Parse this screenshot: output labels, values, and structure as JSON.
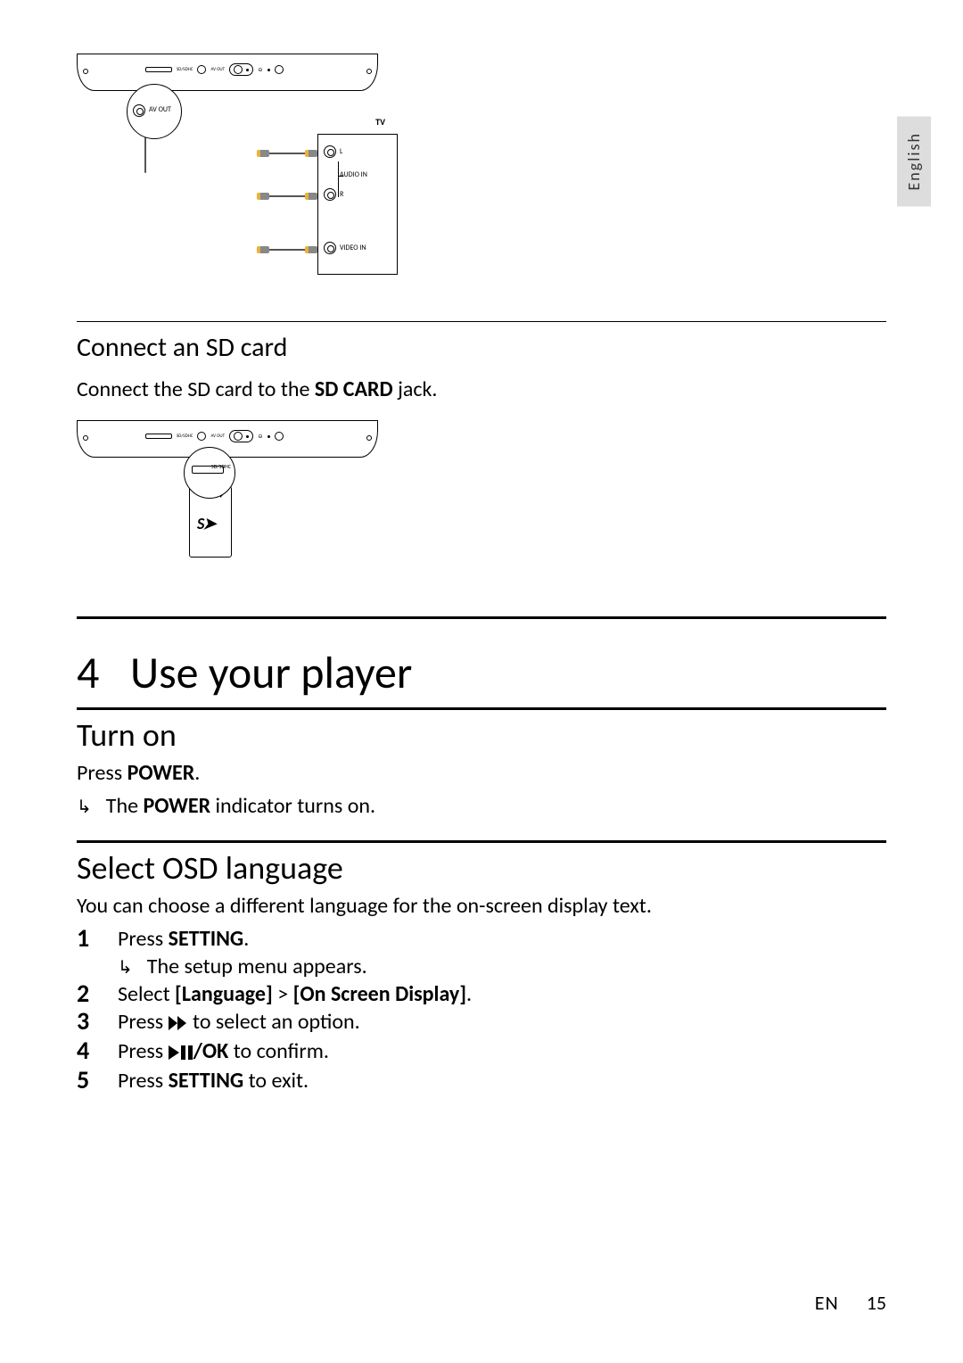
{
  "language_tab": "English",
  "diagram1": {
    "av_out_label": "AV OUT",
    "tv_label": "TV",
    "audio_l": "L",
    "audio_r": "R",
    "audio_in": "AUDIO IN",
    "video_in": "VIDEO IN",
    "sd_tiny": "SD/SDHC",
    "avout_tiny": "AV OUT"
  },
  "diagram2": {
    "sd_tiny": "SD/SDHC",
    "sd_logo": "S➤"
  },
  "subsection_sd_title": "Connect an SD card",
  "sd_instruction_pre": "Connect the SD card to the ",
  "sd_instruction_bold": "SD CARD",
  "sd_instruction_post": " jack.",
  "chapter": {
    "number": "4",
    "title": "Use your player"
  },
  "section_turn_on": {
    "title": "Turn on",
    "line_pre": "Press ",
    "line_bold": "POWER",
    "line_post": ".",
    "result_pre": "The ",
    "result_bold": "POWER",
    "result_post": " indicator turns on."
  },
  "section_osd": {
    "title": "Select OSD language",
    "intro": "You can choose a different language for the on-screen display text.",
    "steps": {
      "s1_pre": "Press ",
      "s1_bold": "SETTING",
      "s1_post": ".",
      "s1_result": "The setup menu appears.",
      "s2_pre": "Select ",
      "s2_b1": "[Language]",
      "s2_mid": " > ",
      "s2_b2": "[On Screen Display]",
      "s2_post": ".",
      "s3_pre": "Press ",
      "s3_post": " to select an option.",
      "s4_pre": "Press ",
      "s4_bold": "/OK",
      "s4_post": " to confirm.",
      "s5_pre": "Press ",
      "s5_bold": "SETTING",
      "s5_post": " to exit."
    }
  },
  "footer": {
    "lang": "EN",
    "page": "15"
  }
}
